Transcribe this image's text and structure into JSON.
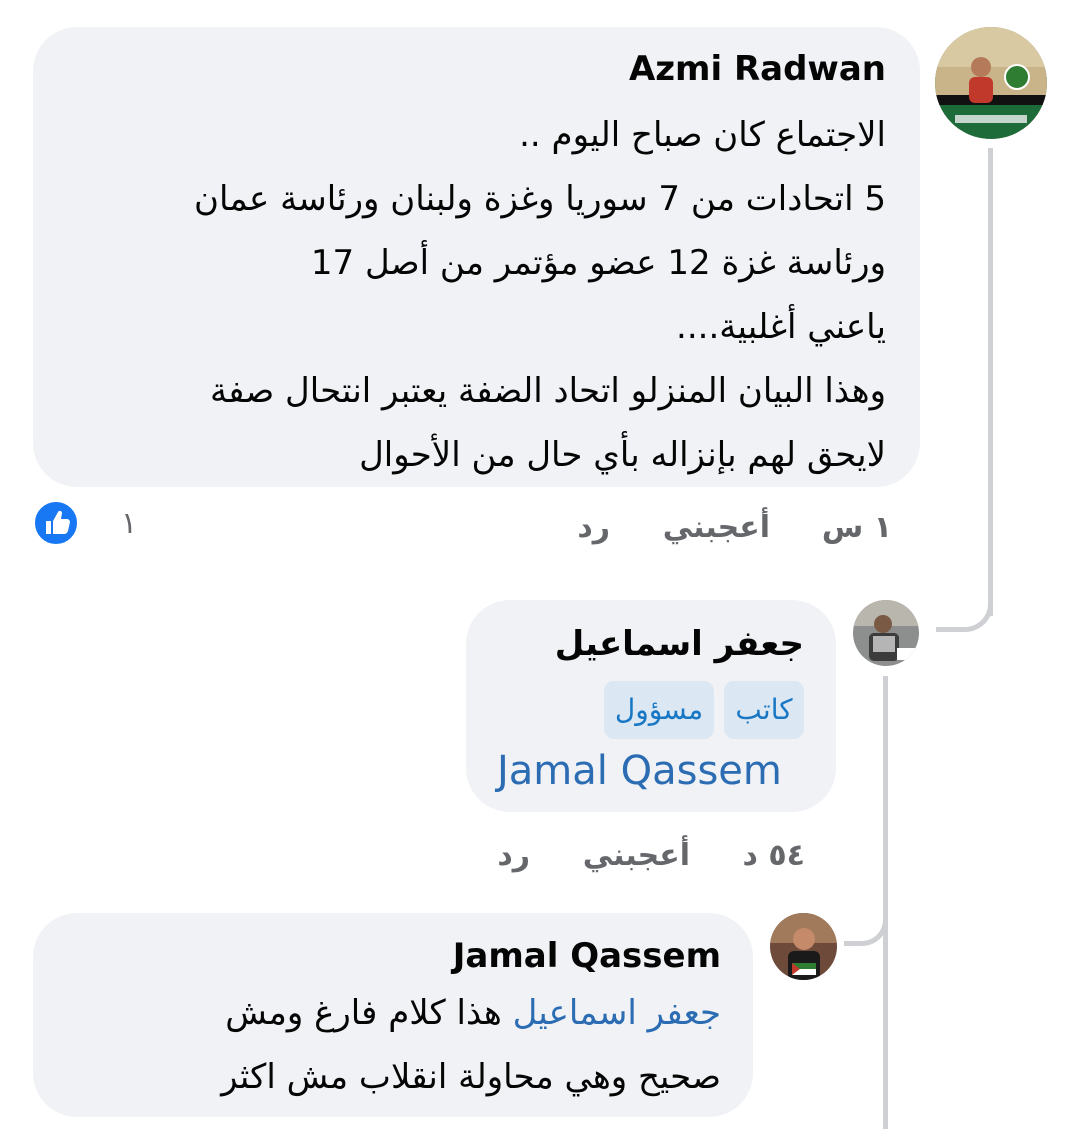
{
  "comments": [
    {
      "author": "Azmi Radwan",
      "lines": [
        "الاجتماع كان صباح اليوم ..",
        "5 اتحادات من 7 سوريا وغزة ولبنان ورئاسة عمان",
        "ورئاسة غزة 12 عضو مؤتمر من أصل 17",
        "ياعني أغلبية....",
        "وهذا البيان المنزلو اتحاد الضفة يعتبر انتحال صفة",
        "لايحق لهم بإنزاله بأي حال من الأحوال"
      ],
      "time": "١ س",
      "like_label": "أعجبني",
      "reply_label": "رد",
      "reaction_count": "١"
    },
    {
      "author": "جعفر اسماعيل",
      "badges": [
        "كاتب",
        "مسؤول"
      ],
      "mention": "Jamal Qassem",
      "time": "٥٤ د",
      "like_label": "أعجبني",
      "reply_label": "رد"
    },
    {
      "author": "Jamal Qassem",
      "mention": "جعفر اسماعيل",
      "line1_rest": " هذا كلام فارغ  ومش",
      "line2": "صحيح وهي محاولة انقلاب مش اكثر"
    }
  ],
  "colors": {
    "bubble": "#f0f2f5",
    "meta_text": "#65676b",
    "link": "#2b6cb3",
    "like_blue": "#1877f2",
    "badge_bg": "#dbe7f2"
  },
  "icons": {
    "reaction": "like-thumb-icon"
  }
}
